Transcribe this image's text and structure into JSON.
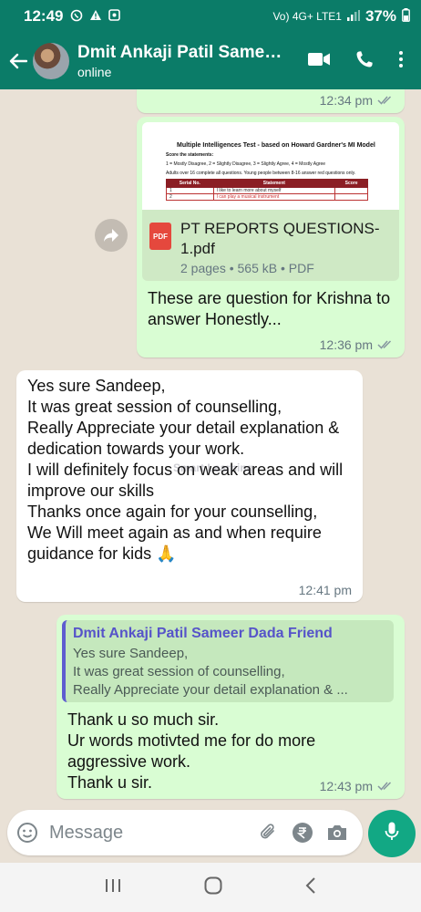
{
  "status_bar": {
    "time": "12:49",
    "network": "Vo) 4G+ LTE1",
    "battery": "37%"
  },
  "header": {
    "contact_name": "Dmit Ankaji Patil Sameer Dada Friend",
    "presence": "online"
  },
  "messages": {
    "m1": {
      "time": "12:34 pm"
    },
    "doc": {
      "preview_title": "Multiple Intelligences Test - based on Howard Gardner's MI Model",
      "preview_line1": "Score the statements:",
      "preview_line2": "1 = Mostly Disagree, 2 = Slightly Disagree, 3 = Slightly Agree, 4 = Mostly Agree",
      "preview_line3": "Adults over 16 complete all questions. Young people between 8-16 answer red questions only.",
      "preview_headers": [
        "Serial No.",
        "Statement",
        "Score"
      ],
      "preview_rows": [
        [
          "1",
          "I like to learn more about myself",
          ""
        ],
        [
          "2",
          "I can play a musical instrument",
          ""
        ]
      ],
      "icon_label": "PDF",
      "file_name": "PT REPORTS QUESTIONS-1.pdf",
      "file_info": "2 pages • 565 kB • PDF",
      "caption": "These are question for Krishna to answer Honestly...",
      "time": "12:36 pm"
    },
    "incoming": {
      "text": "Yes sure Sandeep,\nIt was great session of counselling,\nReally Appreciate your detail explanation &  dedication towards your work.\nI will definitely focus on weak areas and will improve our skills\nThanks once again for your counselling,\nWe Will meet again as and when require guidance for kids 🙏",
      "time": "12:41 pm"
    },
    "reply": {
      "quoted_name": "Dmit Ankaji Patil Sameer Dada Friend",
      "quoted_text": "Yes sure Sandeep,\nIt was great session of counselling,\nReally Appreciate your detail explanation & ...",
      "text": "Thank u so much sir.\nUr words motivted me for do more aggressive work.\nThank u sir.",
      "time": "12:43 pm"
    }
  },
  "watermark": "Smart Learning",
  "composer": {
    "placeholder": "Message"
  },
  "colors": {
    "header": "#0b7c68",
    "outgoing_bubble": "#d9fdd3",
    "incoming_bubble": "#ffffff",
    "chat_background": "#e9e1d6",
    "mic_button": "#12a884",
    "quote_bar": "#5e5cd0"
  }
}
